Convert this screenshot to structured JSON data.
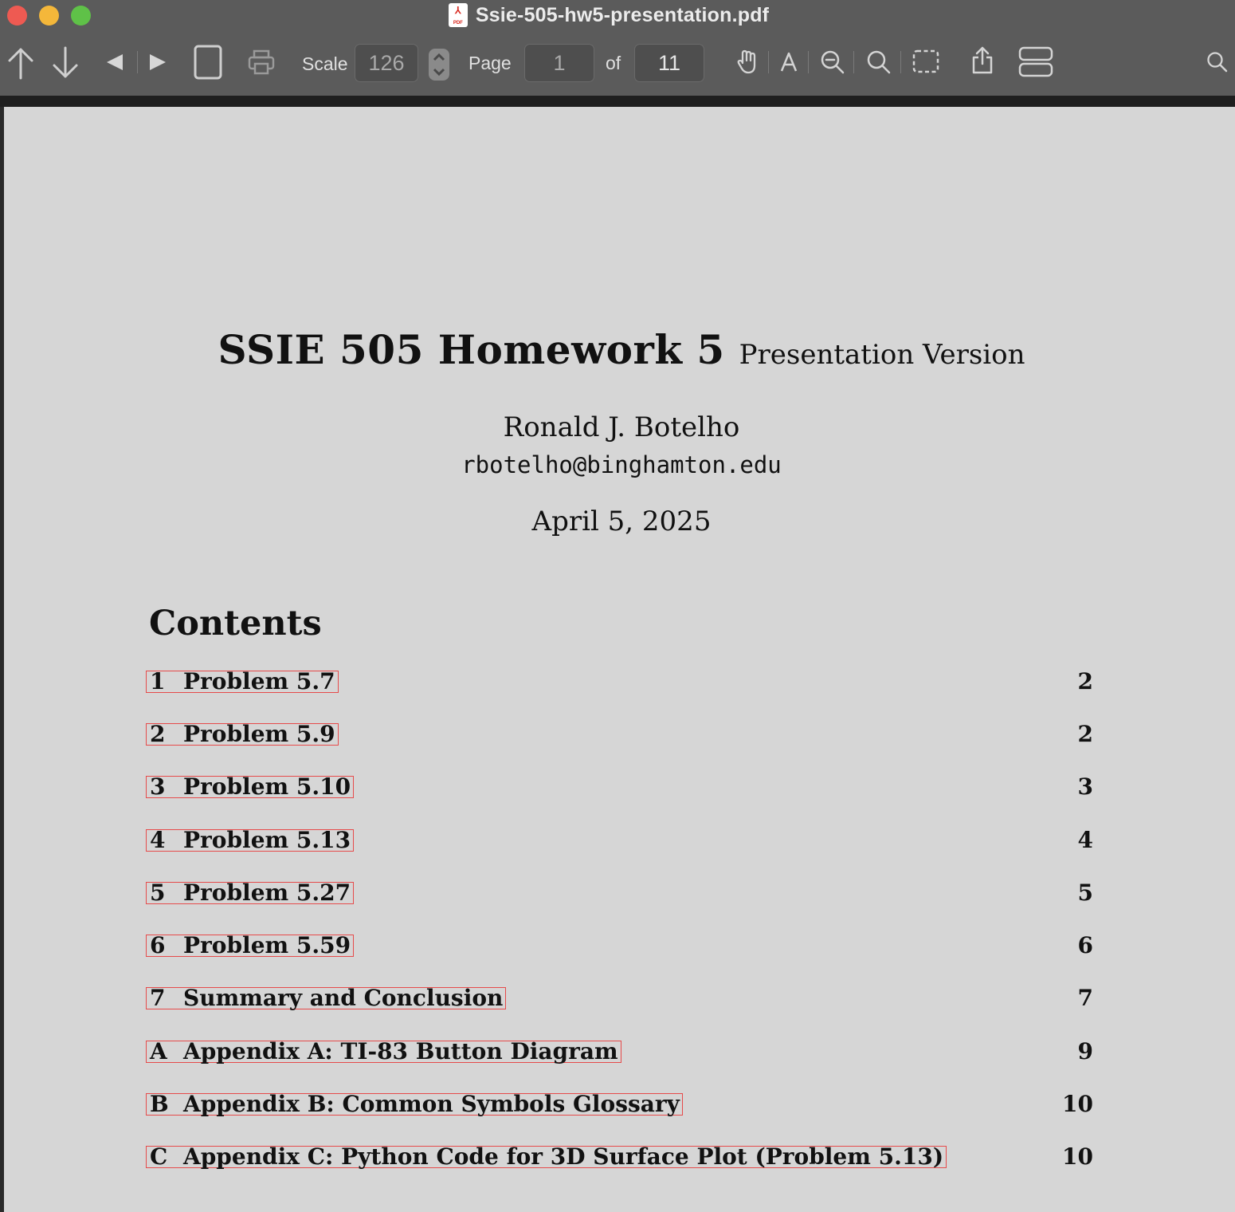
{
  "window": {
    "title": "Ssie-505-hw5-presentation.pdf",
    "file_icon_label": "PDF"
  },
  "toolbar": {
    "scale_label": "Scale",
    "scale_value": "126",
    "page_label": "Page",
    "page_value": "1",
    "of_label": "of",
    "page_total": "11"
  },
  "document": {
    "title": "SSIE 505 Homework 5",
    "subtitle": "Presentation Version",
    "author": "Ronald J. Botelho",
    "email": "rbotelho@binghamton.edu",
    "date": "April 5, 2025",
    "contents_heading": "Contents",
    "toc": [
      {
        "num": "1",
        "title": "Problem 5.7",
        "page": "2"
      },
      {
        "num": "2",
        "title": "Problem 5.9",
        "page": "2"
      },
      {
        "num": "3",
        "title": "Problem 5.10",
        "page": "3"
      },
      {
        "num": "4",
        "title": "Problem 5.13",
        "page": "4"
      },
      {
        "num": "5",
        "title": "Problem 5.27",
        "page": "5"
      },
      {
        "num": "6",
        "title": "Problem 5.59",
        "page": "6"
      },
      {
        "num": "7",
        "title": "Summary and Conclusion",
        "page": "7"
      },
      {
        "num": "A",
        "title": "Appendix A: TI-83 Button Diagram",
        "page": "9"
      },
      {
        "num": "B",
        "title": "Appendix B: Common Symbols Glossary",
        "page": "10"
      },
      {
        "num": "C",
        "title": "Appendix C: Python Code for 3D Surface Plot (Problem 5.13)",
        "page": "10"
      }
    ]
  }
}
